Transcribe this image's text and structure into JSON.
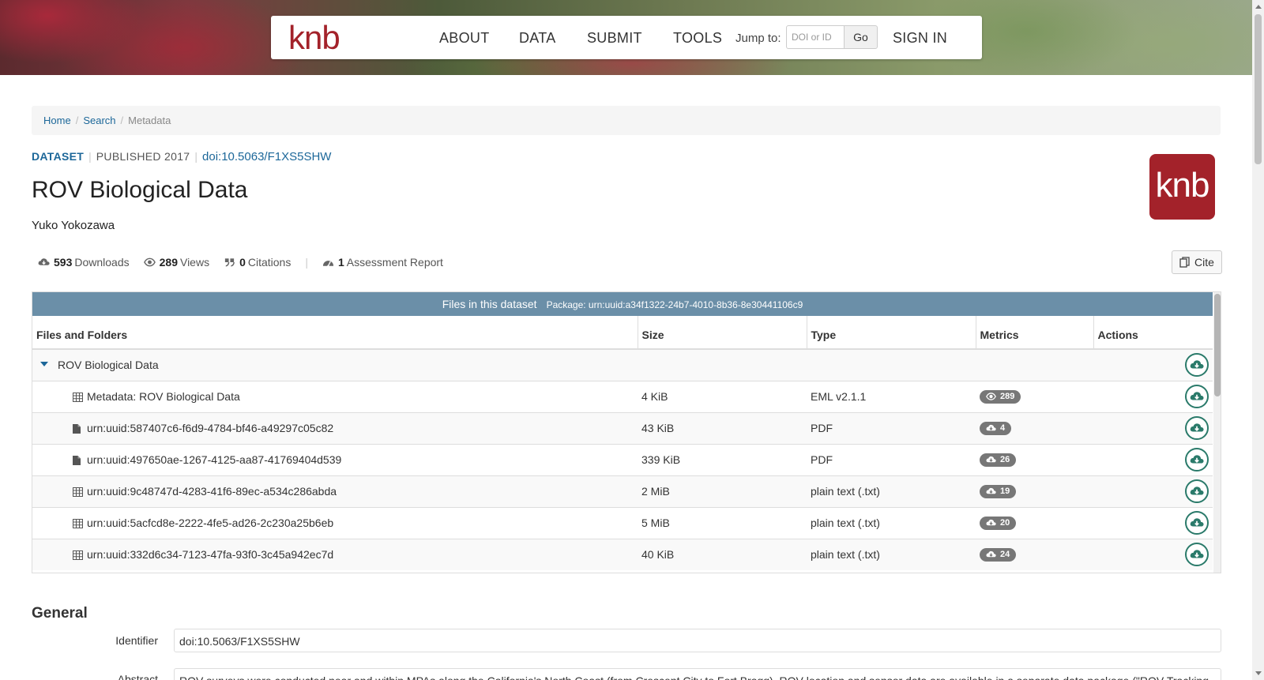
{
  "nav": {
    "logo": "knb",
    "links": [
      "ABOUT",
      "DATA",
      "SUBMIT",
      "TOOLS"
    ],
    "jump_label": "Jump to:",
    "jump_placeholder": "DOI or ID",
    "go_label": "Go",
    "sign_in": "SIGN IN"
  },
  "breadcrumb": {
    "home": "Home",
    "search": "Search",
    "current": "Metadata"
  },
  "dataset": {
    "type_label": "DATASET",
    "published": "PUBLISHED 2017",
    "doi": "doi:10.5063/F1XS5SHW",
    "title": "ROV Biological Data",
    "author": "Yuko Yokozawa",
    "badge": "knb"
  },
  "metrics": {
    "downloads_count": "593",
    "downloads_label": "Downloads",
    "views_count": "289",
    "views_label": "Views",
    "citations_count": "0",
    "citations_label": "Citations",
    "assessment_count": "1",
    "assessment_label": "Assessment Report"
  },
  "cite_label": "Cite",
  "files": {
    "header_title": "Files in this dataset",
    "package_label": "Package: urn:uuid:a34f1322-24b7-4010-8b36-8e30441106c9",
    "columns": [
      "Files and Folders",
      "Size",
      "Type",
      "Metrics",
      "Actions"
    ],
    "folder": "ROV Biological Data",
    "rows": [
      {
        "icon": "table-icon",
        "name": "Metadata: ROV Biological Data",
        "size": "4 KiB",
        "type": "EML v2.1.1",
        "metric_icon": "eye-icon",
        "metric": "289"
      },
      {
        "icon": "file-icon",
        "name": "urn:uuid:587407c6-f6d9-4784-bf46-a49297c05c82",
        "size": "43 KiB",
        "type": "PDF",
        "metric_icon": "cloud-download-icon",
        "metric": "4"
      },
      {
        "icon": "file-icon",
        "name": "urn:uuid:497650ae-1267-4125-aa87-41769404d539",
        "size": "339 KiB",
        "type": "PDF",
        "metric_icon": "cloud-download-icon",
        "metric": "26"
      },
      {
        "icon": "table-icon",
        "name": "urn:uuid:9c48747d-4283-41f6-89ec-a534c286abda",
        "size": "2 MiB",
        "type": "plain text (.txt)",
        "metric_icon": "cloud-download-icon",
        "metric": "19"
      },
      {
        "icon": "table-icon",
        "name": "urn:uuid:5acfcd8e-2222-4fe5-ad26-2c230a25b6eb",
        "size": "5 MiB",
        "type": "plain text (.txt)",
        "metric_icon": "cloud-download-icon",
        "metric": "20"
      },
      {
        "icon": "table-icon",
        "name": "urn:uuid:332d6c34-7123-47fa-93f0-3c45a942ec7d",
        "size": "40 KiB",
        "type": "plain text (.txt)",
        "metric_icon": "cloud-download-icon",
        "metric": "24"
      }
    ]
  },
  "general": {
    "title": "General",
    "identifier_label": "Identifier",
    "identifier_value": "doi:10.5063/F1XS5SHW",
    "abstract_label": "Abstract",
    "abstract_value": "ROV surveys were conducted near and within MPAs along the California's North Coast (from Crescent City to Fort Bragg). ROV location and sensor data are available in a separate data package (\"ROV Tracking"
  },
  "colors": {
    "brand": "#a3222a",
    "link": "#1c6799",
    "table_header": "#6b8fa8",
    "download": "#2a7a6a"
  }
}
